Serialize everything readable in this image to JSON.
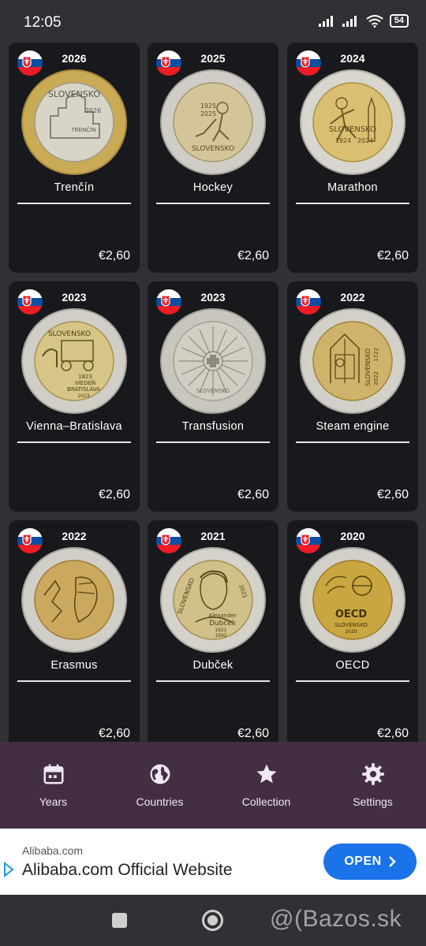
{
  "status_bar": {
    "time": "12:05",
    "battery": "54"
  },
  "coins": [
    {
      "year": "2026",
      "name": "Trenčín",
      "price": "€2,60",
      "center_color": "#d8d4c6",
      "ring_color": "#c9ab55",
      "motif": "castle-town"
    },
    {
      "year": "2025",
      "name": "Hockey",
      "price": "€2,60",
      "center_color": "#d4c49a",
      "ring_color": "#cfcdc5",
      "motif": "hockey-player"
    },
    {
      "year": "2024",
      "name": "Marathon",
      "price": "€2,60",
      "center_color": "#d9bf72",
      "ring_color": "#d8d6ce",
      "motif": "runner"
    },
    {
      "year": "2023",
      "name": "Vienna–Bratislava",
      "price": "€2,60",
      "center_color": "#d6c587",
      "ring_color": "#d0cec6",
      "motif": "horse-railway"
    },
    {
      "year": "2023",
      "name": "Transfusion",
      "price": "€2,60",
      "center_color": "#d2cec3",
      "ring_color": "#c9c6bd",
      "motif": "radiating-cross"
    },
    {
      "year": "2022",
      "name": "Steam engine",
      "price": "€2,60",
      "center_color": "#cfb36a",
      "ring_color": "#d2d0c8",
      "motif": "steam-machine"
    },
    {
      "year": "2022",
      "name": "Erasmus",
      "price": "€2,60",
      "center_color": "#caa85e",
      "ring_color": "#d0cec6",
      "motif": "erasmus-portrait"
    },
    {
      "year": "2021",
      "name": "Dubček",
      "price": "€2,60",
      "center_color": "#d2c08a",
      "ring_color": "#d4d2ca",
      "motif": "dubcek-portrait"
    },
    {
      "year": "2020",
      "name": "OECD",
      "price": "€2,60",
      "center_color": "#c9a640",
      "ring_color": "#d2d0c8",
      "motif": "oecd-globe"
    }
  ],
  "coin_text": {
    "c0": [
      "SLOVENSKO",
      "2026",
      "TRENČÍN"
    ],
    "c1": [
      "1925",
      "2025",
      "SLOVENSKO"
    ],
    "c2": [
      "SLOVENSKO",
      "1924",
      "2024"
    ],
    "c3": [
      "SLOVENSKO",
      "1823",
      "VIEDEŇ",
      "BRATISLAVA",
      "2023"
    ],
    "c4": [
      "SLOVENSKO"
    ],
    "c5": [
      "SLOVENSKO",
      "1722",
      "2022"
    ],
    "c6": [],
    "c7": [
      "SLOVENSKO",
      "Alexander",
      "Dubček",
      "1921",
      "1992",
      "2021"
    ],
    "c8": [
      "OECD",
      "SLOVENSKO",
      "2020"
    ]
  },
  "bottom_nav": [
    {
      "label": "Years",
      "icon": "calendar-icon"
    },
    {
      "label": "Countries",
      "icon": "globe-icon"
    },
    {
      "label": "Collection",
      "icon": "star-icon"
    },
    {
      "label": "Settings",
      "icon": "gear-icon"
    }
  ],
  "ad": {
    "source": "Alibaba.com",
    "title": "Alibaba.com Official Website",
    "button": "OPEN"
  },
  "watermark": "@(Bazos.sk",
  "colors": {
    "background": "#2f3134",
    "card": "#18191c",
    "nav_bar": "#432e44",
    "ad_button": "#1a73e8",
    "flag_white": "#ffffff",
    "flag_blue": "#0b4ea2",
    "flag_red": "#ee1c25"
  }
}
